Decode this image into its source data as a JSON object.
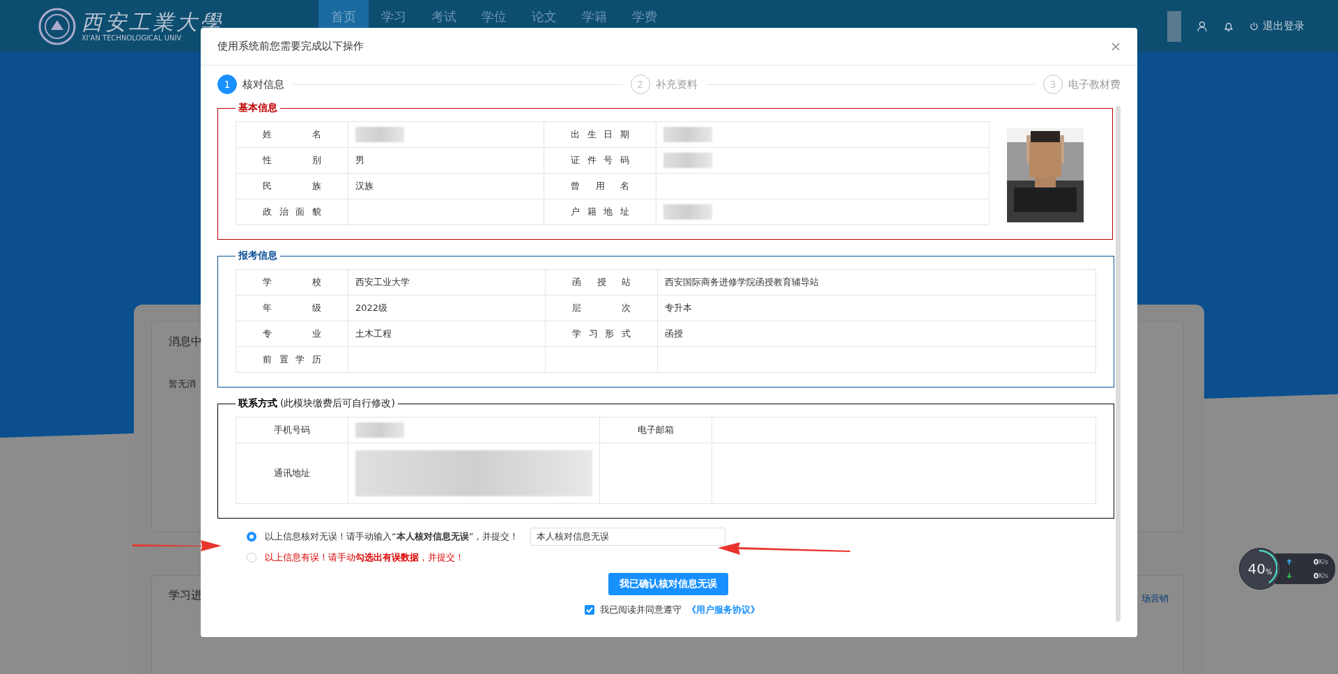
{
  "header": {
    "logo_text": "西安工業大學",
    "logo_subtitle": "XI'AN TECHNOLOGICAL UNIV",
    "nav": [
      {
        "label": "首页",
        "selected": true
      },
      {
        "label": "学习",
        "selected": false
      },
      {
        "label": "考试",
        "selected": false
      },
      {
        "label": "学位",
        "selected": false
      },
      {
        "label": "论文",
        "selected": false
      },
      {
        "label": "学籍",
        "selected": false
      },
      {
        "label": "学费",
        "selected": false
      }
    ],
    "logout": "退出登录"
  },
  "background": {
    "cards": [
      {
        "title": "消息中",
        "body": "暂无消"
      },
      {
        "title": "学习进"
      }
    ],
    "link": "场营销"
  },
  "modal": {
    "title": "使用系统前您需要完成以下操作",
    "steps": [
      {
        "number": "1",
        "label": "核对信息",
        "selected": true
      },
      {
        "number": "2",
        "label": "补充资料",
        "selected": false
      },
      {
        "number": "3",
        "label": "电子教材费",
        "selected": false
      }
    ],
    "sections": [
      {
        "title": "基本信息",
        "color": "#c00000",
        "photo": true,
        "rows": [
          [
            {
              "label": "姓名",
              "blurred": true
            },
            {
              "label": "出生日期",
              "blurred": true
            }
          ],
          [
            {
              "label": "性别",
              "value": "男"
            },
            {
              "label": "证件号码",
              "blurred": true
            }
          ],
          [
            {
              "label": "民族",
              "value": "汉族"
            },
            {
              "label": "曾用名"
            }
          ],
          [
            {
              "label": "政治面貌"
            },
            {
              "label": "户籍地址",
              "blurred": true
            }
          ]
        ]
      },
      {
        "title": "报考信息",
        "color": "#0a4f96",
        "rows": [
          [
            {
              "label": "学校",
              "value": "西安工业大学"
            },
            {
              "label": "函授站",
              "value": "西安国际商务进修学院函授教育辅导站"
            }
          ],
          [
            {
              "label": "年级",
              "value": "2022级"
            },
            {
              "label": "层次",
              "value": "专升本"
            }
          ],
          [
            {
              "label": "专业",
              "value": "土木工程"
            },
            {
              "label": "学习形式",
              "value": "函授"
            }
          ],
          [
            {
              "label": "前置学历"
            },
            {}
          ]
        ]
      },
      {
        "title": "联系方式",
        "subtitle": "(此模块缴费后可自行修改)",
        "color": "#000000",
        "rows": [
          [
            {
              "label": "手机号码",
              "blurred": true
            },
            {
              "label": "电子邮箱"
            }
          ],
          [
            {
              "label": "通讯地址",
              "blurred": true,
              "tall": true
            },
            {}
          ]
        ]
      }
    ],
    "options": [
      {
        "kind": "confirm",
        "text": "以上信息核对无误！请手动输入“**本人核对信息无误**”，并提交！",
        "selected": true,
        "input_value": "本人核对信息无误"
      },
      {
        "kind": "error",
        "text": "以上信息有误！请手动**勾选出有误数据**，并提交！",
        "selected": false
      }
    ],
    "submit": "我已确认核对信息无误",
    "agreement": {
      "checked": true,
      "text": "我已阅读并同意遵守",
      "link": "《用户服务协议》"
    }
  },
  "speed_widget": {
    "percent": "40",
    "unit": "%",
    "up": "0",
    "down": "0",
    "up_unit": "K/s",
    "down_unit": "K/s"
  }
}
